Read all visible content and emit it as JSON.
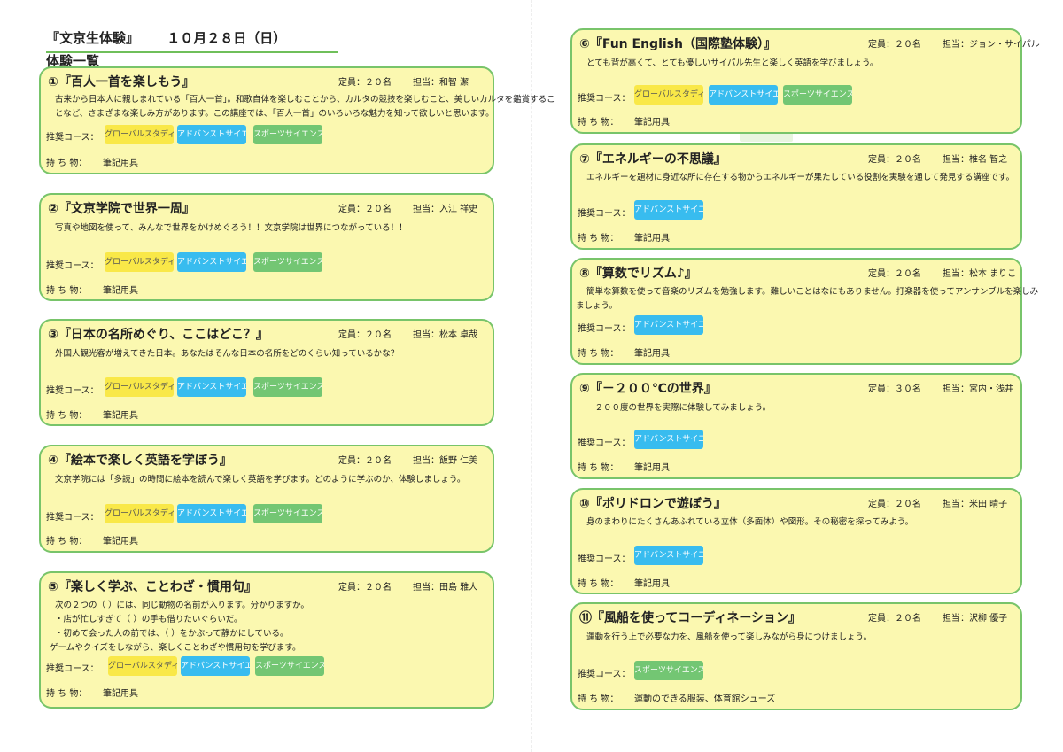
{
  "header": {
    "title": "『文京生体験』",
    "date": "１０月２８日（日）",
    "subtitle": "体験一覧"
  },
  "labels": {
    "course": "推奨コース：",
    "items": "持  ち  物："
  },
  "course_names": {
    "global": "グローバルスタディーズ",
    "advance": "アドバンストサイエンス",
    "sports": "スポーツサイエンス"
  },
  "colors": {
    "card_bg": "#fbf8b0",
    "card_border": "#78c46a",
    "global": "#f9e848",
    "advance": "#38bcef",
    "sports": "#73c673"
  },
  "cards": [
    {
      "title": "①『百人一首を楽しもう』",
      "capacity": "定員：２０名",
      "staff": "担当：和智  潔",
      "desc": [
        "古来から日本人に親しまれている「百人一首」。和歌自体を楽しむことから、カルタの競技を楽しむこと、美しいカルタを鑑賞するこ",
        "となど、さまざまな楽しみ方があります。この講座では、「百人一首」のいろいろな魅力を知って欲しいと思います。"
      ],
      "courses": [
        "グローバルスタディーズ",
        "アドバンストサイエンス",
        "スポーツサイエンス"
      ],
      "items": "筆記用具"
    },
    {
      "title": "②『文京学院で世界一周』",
      "capacity": "定員：２０名",
      "staff": "担当：入江  祥史",
      "desc": [
        "写真や地図を使って、みんなで世界をかけめぐろう！！文京学院は世界につながっている！！"
      ],
      "courses": [
        "グローバルスタディーズ",
        "アドバンストサイエンス",
        "スポーツサイエンス"
      ],
      "items": "筆記用具"
    },
    {
      "title": "③『日本の名所めぐり、ここはどこ？』",
      "capacity": "定員：２０名",
      "staff": "担当：松本  卓哉",
      "desc": [
        "外国人観光客が増えてきた日本。あなたはそんな日本の名所をどのくらい知っているかな？"
      ],
      "courses": [
        "グローバルスタディーズ",
        "アドバンストサイエンス",
        "スポーツサイエンス"
      ],
      "items": "筆記用具"
    },
    {
      "title": "④『絵本で楽しく英語を学ぼう』",
      "capacity": "定員：２０名",
      "staff": "担当：飯野  仁美",
      "desc": [
        "文京学院には「多読」の時間に絵本を読んで楽しく英語を学びます。どのように学ぶのか、体験しましょう。"
      ],
      "courses": [
        "グローバルスタディーズ",
        "アドバンストサイエンス",
        "スポーツサイエンス"
      ],
      "items": "筆記用具"
    },
    {
      "title": "⑤『楽しく学ぶ、ことわざ・慣用句』",
      "capacity": "定員：２０名",
      "staff": "担当：田島  雅人",
      "desc": [
        "次の２つの（     ）には、同じ動物の名前が入ります。分かりますか。",
        "・店が忙しすぎて（     ）の手も借りたいぐらいだ。",
        "・初めて会った人の前では、（     ）をかぶって静かにしている。",
        "ゲームやクイズをしながら、楽しくことわざや慣用句を学びます。"
      ],
      "courses": [
        "グローバルスタディーズ",
        "アドバンストサイエンス",
        "スポーツサイエンス"
      ],
      "items": "筆記用具"
    },
    {
      "title": "⑥『Fun English（国際塾体験）』",
      "capacity": "定員：２０名",
      "staff": "担当：ジョン・サイパル",
      "desc": [
        "とても背が高くて、とても優しいサイパル先生と楽しく英語を学びましょう。"
      ],
      "courses": [
        "グローバルスタディーズ",
        "アドバンストサイエンス",
        "スポーツサイエンス"
      ],
      "items": "筆記用具"
    },
    {
      "title": "⑦『エネルギーの不思議』",
      "capacity": "定員：２０名",
      "staff": "担当：椎名  智之",
      "desc": [
        "エネルギーを題材に身近な所に存在する物からエネルギーが果たしている役割を実験を通して発見する講座です。"
      ],
      "courses": [
        "アドバンストサイエンス"
      ],
      "items": "筆記用具"
    },
    {
      "title": "⑧『算数でリズム♪』",
      "capacity": "定員：２０名",
      "staff": "担当：松本  まりこ",
      "desc": [
        "簡単な算数を使って音楽のリズムを勉強します。難しいことはなにもありません。打楽器を使ってアンサンブルを楽しみ",
        "ましょう。"
      ],
      "courses": [
        "アドバンストサイエンス"
      ],
      "items": "筆記用具"
    },
    {
      "title": "⑨『－２００℃の世界』",
      "capacity": "定員：３０名",
      "staff": "担当：宮内・浅井",
      "desc": [
        "－２００度の世界を実際に体験してみましょう。"
      ],
      "courses": [
        "アドバンストサイエンス"
      ],
      "items": "筆記用具"
    },
    {
      "title": "⑩『ポリドロンで遊ぼう』",
      "capacity": "定員：２０名",
      "staff": "担当：米田  晴子",
      "desc": [
        "身のまわりにたくさんあふれている立体（多面体）や図形。その秘密を探ってみよう。"
      ],
      "courses": [
        "アドバンストサイエンス"
      ],
      "items": "筆記用具"
    },
    {
      "title": "⑪『風船を使ってコーディネーション』",
      "capacity": "定員：２０名",
      "staff": "担当：沢柳  優子",
      "desc": [
        "運動を行う上で必要な力を、風船を使って楽しみながら身につけましょう。"
      ],
      "courses": [
        "スポーツサイエンス"
      ],
      "items": "運動のできる服装、体育館シューズ"
    }
  ]
}
